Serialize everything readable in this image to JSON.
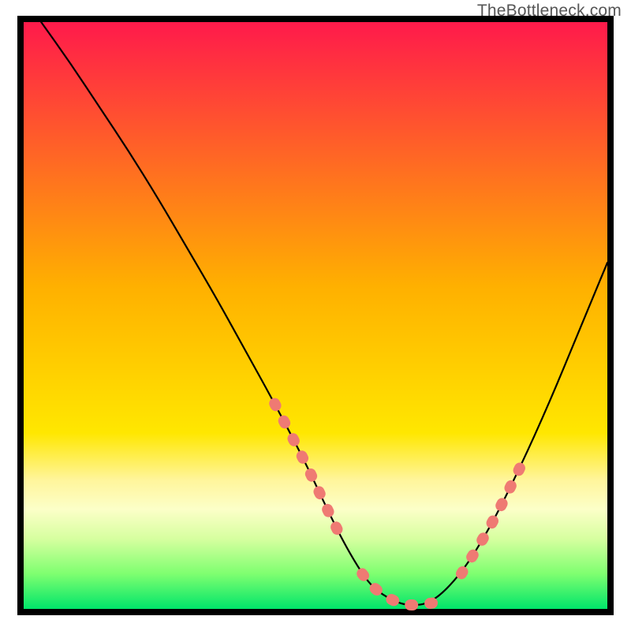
{
  "watermark": "TheBottleneck.com",
  "chart_data": {
    "type": "line",
    "title": "",
    "xlabel": "",
    "ylabel": "",
    "xlim": [
      0,
      100
    ],
    "ylim": [
      0,
      100
    ],
    "background_gradient": {
      "stops": [
        {
          "offset": 0.0,
          "color": "#ff1a4b"
        },
        {
          "offset": 0.45,
          "color": "#ffb000"
        },
        {
          "offset": 0.7,
          "color": "#ffe700"
        },
        {
          "offset": 0.78,
          "color": "#fff59b"
        },
        {
          "offset": 0.83,
          "color": "#fcffc8"
        },
        {
          "offset": 0.88,
          "color": "#d7ffa0"
        },
        {
          "offset": 0.94,
          "color": "#7fff70"
        },
        {
          "offset": 1.0,
          "color": "#00e56a"
        }
      ]
    },
    "curve": {
      "x": [
        3,
        8,
        13,
        18,
        23,
        28,
        33,
        38,
        43,
        48,
        52,
        55,
        58,
        60,
        63,
        66,
        70,
        75,
        80,
        85,
        90,
        95,
        100
      ],
      "y": [
        100,
        93,
        85.5,
        78,
        70,
        61.5,
        53,
        44,
        35,
        25.5,
        17,
        11,
        6,
        3.5,
        1.5,
        0.5,
        1,
        6,
        14,
        24,
        35,
        47,
        59
      ]
    },
    "highlight_segments": {
      "left": {
        "x_start": 43,
        "x_end": 55
      },
      "floor": {
        "x_start": 58,
        "x_end": 70
      },
      "right": {
        "x_start": 77,
        "x_end": 86
      }
    },
    "colors": {
      "frame": "#000000",
      "curve": "#000000",
      "highlight": "#ef7a73",
      "floor_band": "#00e56a"
    }
  }
}
